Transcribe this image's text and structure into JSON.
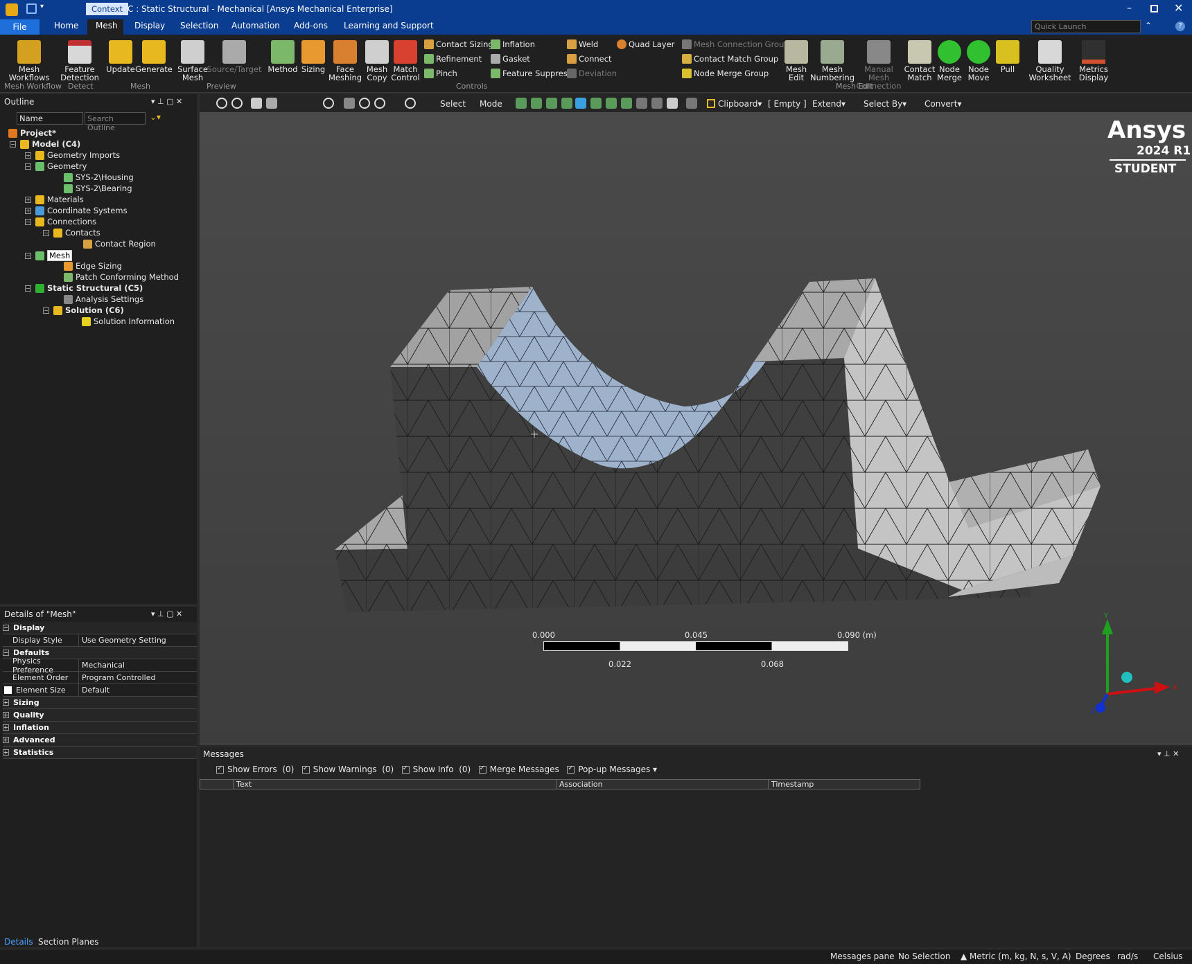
{
  "title": {
    "context": "Context",
    "text": "C : Static Structural - Mechanical [Ansys Mechanical Enterprise]"
  },
  "menu": {
    "file": "File",
    "tabs": [
      "Home",
      "Mesh",
      "Display",
      "Selection",
      "Automation",
      "Add-ons",
      "Learning and Support"
    ],
    "quick_launch": "Quick Launch"
  },
  "ribbon": {
    "mesh_workflows": [
      "Mesh",
      "Workflows"
    ],
    "feature_detection": [
      "Feature",
      "Detection"
    ],
    "update": "Update",
    "generate": "Generate",
    "surface_mesh": [
      "Surface",
      "Mesh"
    ],
    "source_target": "Source/Target",
    "method": "Method",
    "sizing": "Sizing",
    "face_meshing": [
      "Face",
      "Meshing"
    ],
    "mesh_copy": [
      "Mesh",
      "Copy"
    ],
    "match_control": [
      "Match",
      "Control"
    ],
    "contact_sizing": "Contact Sizing",
    "refinement": "Refinement",
    "pinch": "Pinch",
    "inflation": "Inflation",
    "gasket": "Gasket",
    "feature_suppress": "Feature Suppress",
    "weld": "Weld",
    "connect": "Connect",
    "deviation": "Deviation",
    "quad_layer": "Quad Layer",
    "mesh_connection_group": "Mesh Connection Group",
    "contact_match_group": "Contact Match Group",
    "node_merge_group": "Node Merge Group",
    "mesh_edit": [
      "Mesh",
      "Edit"
    ],
    "mesh_numbering": [
      "Mesh",
      "Numbering"
    ],
    "manual_mesh_connection": [
      "Manual Mesh",
      "Connection"
    ],
    "contact_match": [
      "Contact",
      "Match"
    ],
    "node_merge": [
      "Node",
      "Merge"
    ],
    "node_move": [
      "Node",
      "Move"
    ],
    "pull": "Pull",
    "quality_worksheet": [
      "Quality",
      "Worksheet"
    ],
    "metrics_display": [
      "Metrics",
      "Display"
    ],
    "groups": {
      "mesh_workflow": "Mesh Workflow",
      "detect": "Detect",
      "mesh": "Mesh",
      "preview": "Preview",
      "controls": "Controls",
      "mesh_edit": "Mesh Edit"
    }
  },
  "outline": {
    "title": "Outline",
    "filter_label": "Name",
    "search_placeholder": "Search Outline",
    "items": [
      "Project*",
      "Model (C4)",
      "Geometry Imports",
      "Geometry",
      "SYS-2\\Housing",
      "SYS-2\\Bearing",
      "Materials",
      "Coordinate Systems",
      "Connections",
      "Contacts",
      "Contact Region",
      "Mesh",
      "Edge Sizing",
      "Patch Conforming Method",
      "Static Structural (C5)",
      "Analysis Settings",
      "Solution (C6)",
      "Solution Information"
    ]
  },
  "toolbar": {
    "select": "Select",
    "mode": "Mode",
    "clipboard": "Clipboard",
    "empty": "[ Empty ]",
    "extend": "Extend",
    "select_by": "Select By",
    "convert": "Convert"
  },
  "details": {
    "title": "Details of \"Mesh\"",
    "sections": [
      "Display",
      "Defaults",
      "Sizing",
      "Quality",
      "Inflation",
      "Advanced",
      "Statistics"
    ],
    "rows": [
      {
        "key": "Display Style",
        "value": "Use Geometry Setting"
      },
      {
        "key": "Physics Preference",
        "value": "Mechanical"
      },
      {
        "key": "Element Order",
        "value": "Program Controlled"
      },
      {
        "key": "Element Size",
        "value": "Default"
      }
    ],
    "tabs": [
      "Details",
      "Section Planes"
    ]
  },
  "watermark": {
    "brand": "Ansys",
    "version": "2024 R1",
    "edition": "STUDENT"
  },
  "scale": {
    "top": [
      "0.000",
      "0.045",
      "0.090 (m)"
    ],
    "bottom": [
      "0.022",
      "0.068"
    ]
  },
  "axis": {
    "x": "X",
    "y": "Y",
    "z": "Z"
  },
  "messages": {
    "title": "Messages",
    "show_errors": "Show Errors",
    "errors": "(0)",
    "show_warnings": "Show Warnings",
    "warnings": "(0)",
    "show_info": "Show Info",
    "info": "(0)",
    "merge": "Merge Messages",
    "popup": "Pop-up Messages",
    "cols": [
      "Text",
      "Association",
      "Timestamp"
    ]
  },
  "status": {
    "pane": "Messages pane",
    "selection": "No Selection",
    "units": "Metric (m, kg, N, s, V, A)",
    "angle": "Degrees",
    "rate": "rad/s",
    "temp": "Celsius"
  },
  "colors": {
    "accent": "#0a3d8f",
    "active_tab": "#2b2b2b",
    "mesh_light": "#9aa9c0",
    "mesh_grey": "#9c9c9c",
    "mesh_dark": "#3e3e3e"
  }
}
